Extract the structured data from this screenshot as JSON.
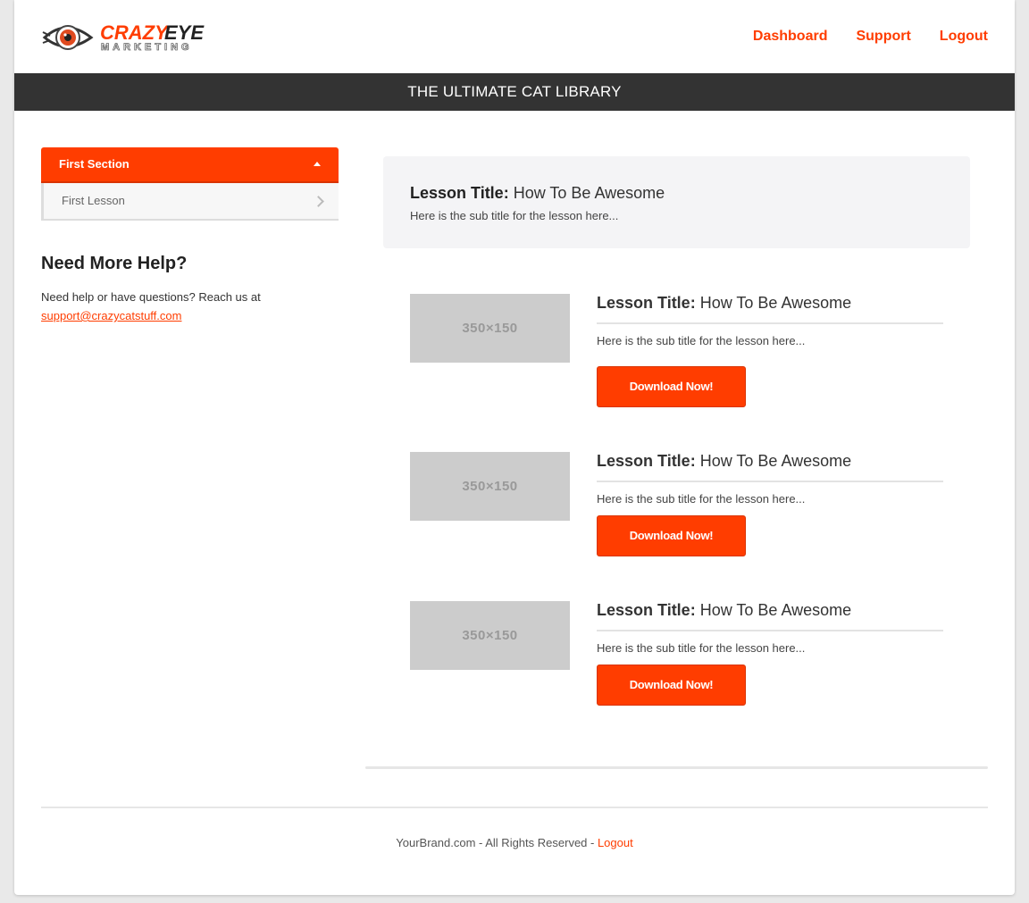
{
  "brand": {
    "logo_word_1": "CRAZY",
    "logo_word_2": "EYE",
    "logo_word_3": "MARKETING",
    "accent_color": "#ff3d00",
    "dark_color": "#333333"
  },
  "nav": {
    "items": [
      {
        "label": "Dashboard"
      },
      {
        "label": "Support"
      },
      {
        "label": "Logout"
      }
    ]
  },
  "titlebar": {
    "title": "THE ULTIMATE CAT LIBRARY"
  },
  "sidebar": {
    "section_label": "First Section",
    "lessons": [
      {
        "label": "First Lesson"
      }
    ],
    "help_title": "Need More Help?",
    "help_text": "Need help or have questions? Reach us at",
    "help_email": "support@crazycatstuff.com"
  },
  "hero": {
    "title_prefix": "Lesson Title:",
    "title": "How To Be Awesome",
    "subtitle": "Here is the sub title for the lesson here..."
  },
  "lessons": [
    {
      "thumb_text": "350×150",
      "title_prefix": "Lesson Title:",
      "title": "How To Be Awesome",
      "subtitle": "Here is the sub title for the lesson here...",
      "button_label": "Download Now!"
    },
    {
      "thumb_text": "350×150",
      "title_prefix": "Lesson Title:",
      "title": "How To Be Awesome",
      "subtitle": "Here is the sub title for the lesson here...",
      "button_label": "Download Now!"
    },
    {
      "thumb_text": "350×150",
      "title_prefix": "Lesson Title:",
      "title": "How To Be Awesome",
      "subtitle": "Here is the sub title for the lesson here...",
      "button_label": "Download Now!"
    }
  ],
  "footer": {
    "text": "YourBrand.com - All Rights Reserved - ",
    "logout_label": "Logout"
  }
}
